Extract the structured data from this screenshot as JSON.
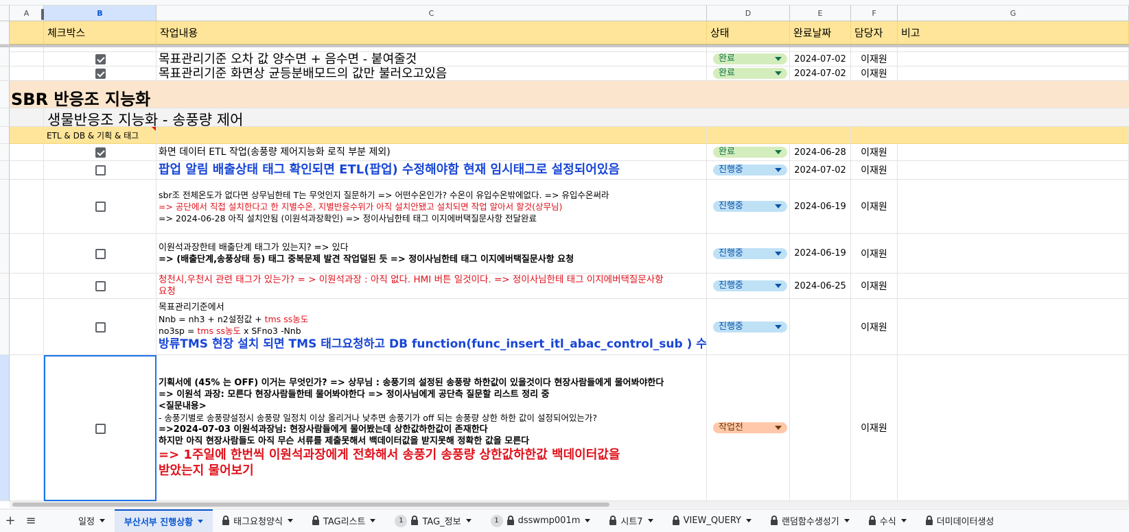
{
  "columns": {
    "a": "A",
    "b": "B",
    "c": "C",
    "d": "D",
    "e": "E",
    "f": "F",
    "g": "G"
  },
  "header": {
    "checkbox": "체크박스",
    "task": "작업내용",
    "status": "상태",
    "done_date": "완료날짜",
    "owner": "담당자",
    "note": "비고"
  },
  "rows": [
    {
      "checked": true,
      "task": "목표관리기준 오차 값 양수면 + 음수면 - 붙여줄것",
      "status": "완료",
      "date": "2024-07-02",
      "owner": "이재원"
    },
    {
      "checked": true,
      "task": "목표관리기준 화면상 균등분배모드의 값만 불러오고있음",
      "status": "완료",
      "date": "2024-07-02",
      "owner": "이재원"
    }
  ],
  "section": {
    "title": "SBR 반응조 지능화"
  },
  "subsection": {
    "title": "생물반응조 지능화 - 송풍량 제어"
  },
  "category": {
    "label": "ETL & DB & 기획 & 태그"
  },
  "tasks": [
    {
      "checked": true,
      "lines": [
        "화면 데이터 ETL 작업(송풍량 제어지능화 로직 부분 제외)"
      ],
      "status": "완료",
      "date": "2024-06-28",
      "owner": "이재원"
    },
    {
      "checked": false,
      "lines": [
        "팝업 알림 배출상태 태그 확인되면 ETL(팝업) 수정해야함 현재 임시태그로 설정되어있음"
      ],
      "status": "진행중",
      "date": "2024-07-02",
      "owner": "이재원"
    },
    {
      "checked": false,
      "lines": [
        "sbr조 전체온도가 없다면 상무님한테 T는 무엇인지 질문하기 => 어떤수온인가? 수온이 유입수온밖에없다. => 유입수온써라",
        "=> 공단에서 직접 설치한다고 한 지별수온, 지별반응수위가 아직 설치안됐고 설치되면 작업 알아서 할것(상무님)",
        "=> 2024-06-28 아직 설치안됨 (이원석과장확인)  => 정이사님한테 태그 이지에버택질문사항 전달완료"
      ],
      "status": "진행중",
      "date": "2024-06-19",
      "owner": "이재원"
    },
    {
      "checked": false,
      "lines": [
        "이원석과장한테 배출단계 태그가 있는지? =>  있다",
        "=> (배출단계,송풍상태 등) 태그 중복문제 발견 작업덜된 듯 => 정이사님한테 태그 이지에버택질문사항 요청"
      ],
      "status": "진행중",
      "date": "2024-06-19",
      "owner": "이재원"
    },
    {
      "checked": false,
      "lines": [
        "청천시,우천시 관련 태그가 있는가? = > 이원석과장 : 아직 없다. HMI 버튼 일것이다. => 정이사님한테 태그 이지에버택질문사항",
        "요청"
      ],
      "status": "진행중",
      "date": "2024-06-25",
      "owner": "이재원"
    },
    {
      "checked": false,
      "lines": [
        "목표관리기준에서",
        "Nnb = nh3 + n2설정값 + ",
        "tms ss농도",
        "no3sp = ",
        "tms ss농도",
        " x SFno3 -Nnb",
        "방류TMS 현장 설치 되면 TMS 태그요청하고 DB function(func_insert_itl_abac_control_sub ) 수정해야함"
      ],
      "status": "진행중",
      "date": "",
      "owner": "이재원"
    },
    {
      "checked": false,
      "lines": [
        "기획서에 (45% 는 OFF) 이거는 무엇인가? => 상무님 : 송풍기의 설정된 송풍량 하한값이 있을것이다 현장사람들에게 물어봐야한다",
        "=> 이원석 과장: 모른다 현장사람들한테 물어봐야한다 => 정이사님에게 공단측 질문할 리스트 정리 중",
        "<질문내용>",
        "- 송풍기별로 송풍량설정시 송풍량 일정치 이상 올리거나 낮추면 송풍기가 off 되는 송풍량 상한 하한 값이 설정되어있는가?",
        "=>2024-07-03 이원석과장님: 현장사람들에게 물어봤는데 상한값하한값이 존재한다",
        "하지만 아직 현장사람들도 아직 무슨 서류를 제출못해서 백데이터값을 받지못해 정확한 값을 모른다",
        " => 1주일에 한번씩 이원석과장에게 전화해서 송풍기 송풍량 상한값하한값 백데이터값을",
        "받았는지 물어보기"
      ],
      "status": "작업전",
      "date": "",
      "owner": "이재원"
    }
  ],
  "tabs": {
    "add": "+",
    "menu": "≡",
    "items": [
      {
        "label": "일정",
        "locked": false,
        "badge": ""
      },
      {
        "label": "부산서부 진행상황",
        "locked": false,
        "badge": "",
        "active": true
      },
      {
        "label": "태그요청양식",
        "locked": true,
        "badge": ""
      },
      {
        "label": "TAG리스트",
        "locked": true,
        "badge": ""
      },
      {
        "label": "TAG_정보",
        "locked": true,
        "badge": "1"
      },
      {
        "label": "dsswmp001m",
        "locked": true,
        "badge": "1"
      },
      {
        "label": "시트7",
        "locked": true,
        "badge": ""
      },
      {
        "label": "VIEW_QUERY",
        "locked": true,
        "badge": ""
      },
      {
        "label": "랜덤함수생성기",
        "locked": true,
        "badge": ""
      },
      {
        "label": "수식",
        "locked": true,
        "badge": ""
      },
      {
        "label": "더미데이터생성",
        "locked": true,
        "badge": ""
      }
    ]
  },
  "colors": {
    "done": "#d4edbc",
    "in_progress": "#bfe1f6",
    "todo": "#ffc8aa",
    "header": "#ffe599",
    "section": "#fce5cd"
  }
}
